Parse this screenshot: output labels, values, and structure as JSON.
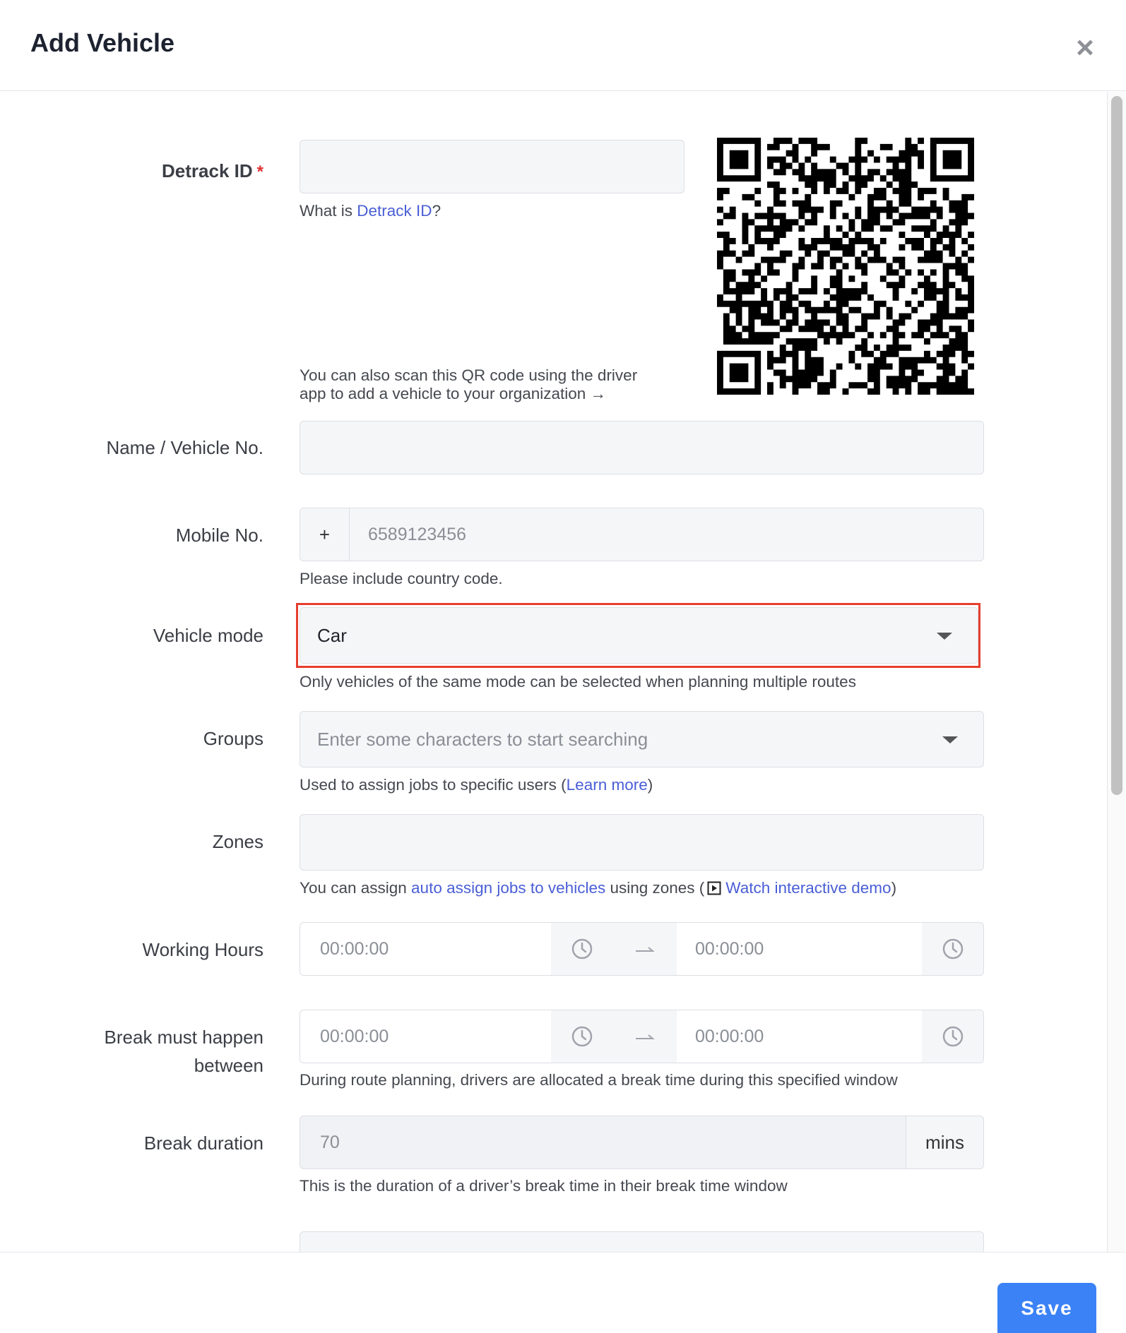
{
  "header": {
    "title": "Add Vehicle",
    "close_label": "×"
  },
  "detrack_id": {
    "label": "Detrack ID",
    "required_mark": "*",
    "value": "",
    "help_prefix": "What is ",
    "help_link": "Detrack ID",
    "help_suffix": "?",
    "qr_note_line1": "You can also scan this QR code using the driver",
    "qr_note_line2": "app to add a vehicle to your organization →"
  },
  "name": {
    "label": "Name / Vehicle No.",
    "value": ""
  },
  "mobile": {
    "label": "Mobile No.",
    "prefix": "+",
    "placeholder": "6589123456",
    "help": "Please include country code."
  },
  "vehicle_mode": {
    "label": "Vehicle mode",
    "value": "Car",
    "help": "Only vehicles of the same mode can be selected when planning multiple routes"
  },
  "groups": {
    "label": "Groups",
    "placeholder": "Enter some characters to start searching",
    "help_prefix": "Used to assign jobs to specific users (",
    "help_link": "Learn more",
    "help_suffix": ")"
  },
  "zones": {
    "label": "Zones",
    "value": "",
    "help_prefix": "You can assign ",
    "help_link1": "auto assign jobs to vehicles",
    "help_middle": " using zones (",
    "help_link2": "Watch interactive demo",
    "help_suffix": ")"
  },
  "working_hours": {
    "label": "Working Hours",
    "start": "00:00:00",
    "end": "00:00:00"
  },
  "break_window": {
    "label_line1": "Break must happen",
    "label_line2": "between",
    "start": "00:00:00",
    "end": "00:00:00",
    "help": "During route planning, drivers are allocated a break time during this specified window"
  },
  "break_duration": {
    "label": "Break duration",
    "value": "70",
    "unit": "mins",
    "help": "This is the duration of a driver’s break time in their break time window"
  },
  "footer": {
    "save_label": "Save"
  },
  "icons": {
    "close": "close-icon",
    "caret": "chevron-down-icon",
    "clock": "clock-icon",
    "arrow": "arrow-right-icon",
    "play": "play-box-icon",
    "qr": "qr-code"
  },
  "colors": {
    "accent": "#3b82f6",
    "link": "#4a5ed6",
    "required": "#e03131",
    "highlight": "#e53e2e"
  }
}
